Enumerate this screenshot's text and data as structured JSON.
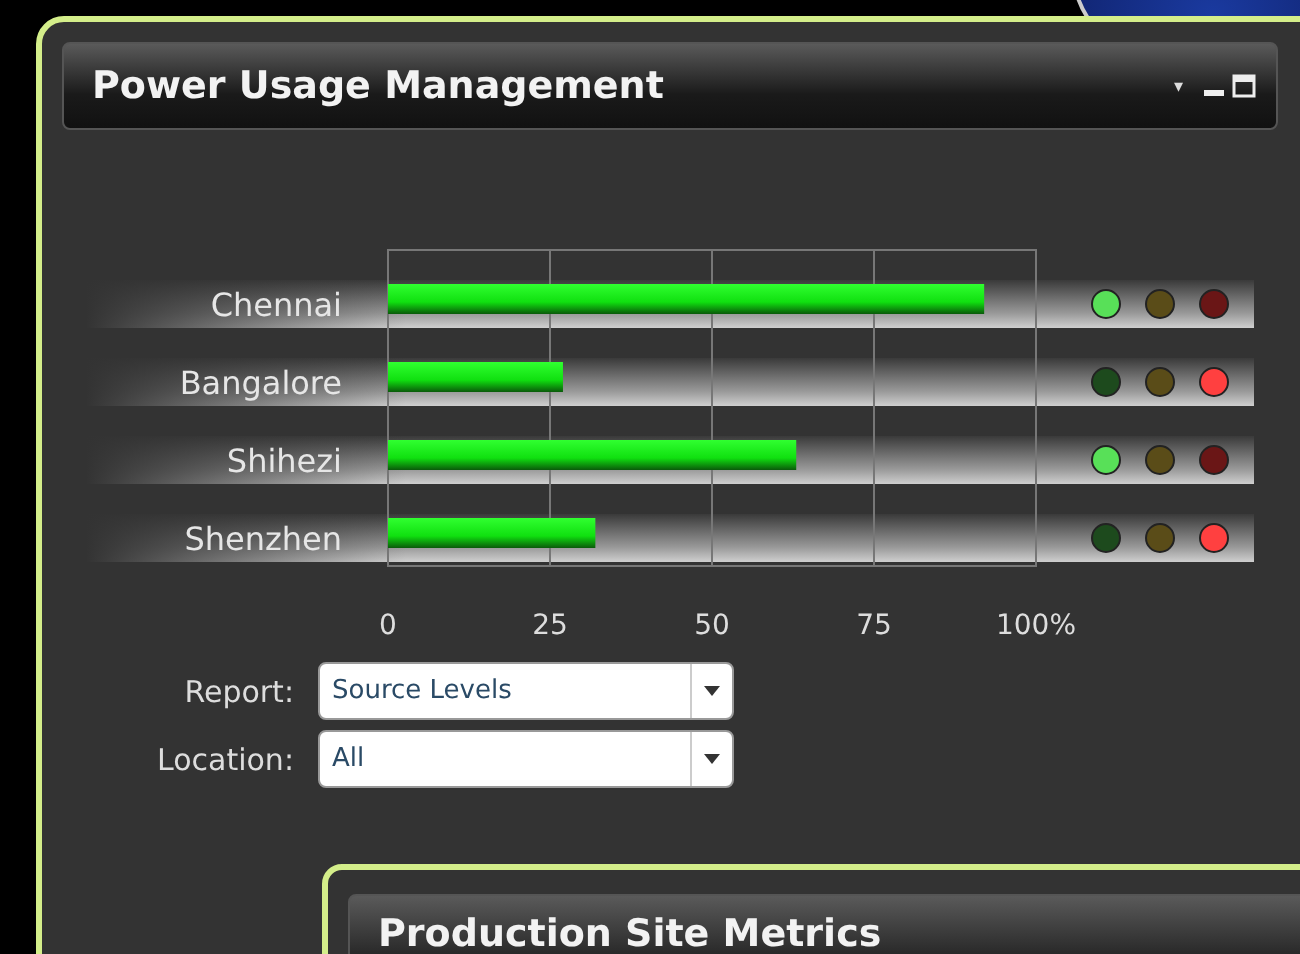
{
  "panel": {
    "title": "Power Usage Management",
    "controls": [
      "▾"
    ]
  },
  "chart": {
    "chart_data": {
      "type": "bar",
      "orientation": "horizontal",
      "categories": [
        "Chennai",
        "Bangalore",
        "Shihezi",
        "Shenzhen"
      ],
      "values": [
        92,
        27,
        63,
        32
      ],
      "xlim": [
        0,
        100
      ],
      "grid": true,
      "xticks": [
        0,
        25,
        50,
        75,
        {
          "value": 100,
          "label": "100%"
        }
      ]
    },
    "indicators": [
      {
        "green": true,
        "yellow": false,
        "red": false
      },
      {
        "green": false,
        "yellow": false,
        "red": true
      },
      {
        "green": true,
        "yellow": false,
        "red": false
      },
      {
        "green": false,
        "yellow": false,
        "red": true
      }
    ]
  },
  "filters": [
    {
      "label": "Report:",
      "value": "Source Levels"
    },
    {
      "label": "Location:",
      "value": "All"
    }
  ],
  "second_panel": {
    "title": "Production Site Metrics"
  }
}
